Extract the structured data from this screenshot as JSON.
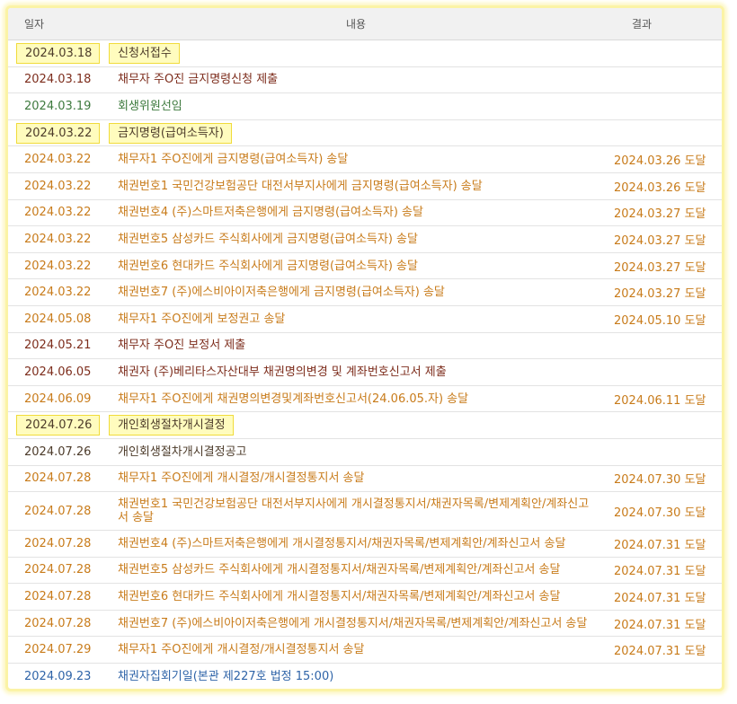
{
  "table": {
    "headers": {
      "date": "일자",
      "content": "내용",
      "result": "결과"
    },
    "rows": [
      {
        "date": "2024.03.18",
        "content": "신청서접수",
        "result": "",
        "color": "dark",
        "highlight": true
      },
      {
        "date": "2024.03.18",
        "content": "채무자 주O진 금지명령신청 제출",
        "result": "",
        "color": "maroon"
      },
      {
        "date": "2024.03.19",
        "content": "회생위원선임",
        "result": "",
        "color": "green"
      },
      {
        "date": "2024.03.22",
        "content": "금지명령(급여소득자)",
        "result": "",
        "color": "dark",
        "highlight": true
      },
      {
        "date": "2024.03.22",
        "content": "채무자1 주O진에게 금지명령(급여소득자) 송달",
        "result": "2024.03.26 도달",
        "color": "orange"
      },
      {
        "date": "2024.03.22",
        "content": "채권번호1 국민건강보험공단 대전서부지사에게 금지명령(급여소득자) 송달",
        "result": "2024.03.26 도달",
        "color": "orange"
      },
      {
        "date": "2024.03.22",
        "content": "채권번호4 (주)스마트저축은행에게 금지명령(급여소득자) 송달",
        "result": "2024.03.27 도달",
        "color": "orange"
      },
      {
        "date": "2024.03.22",
        "content": "채권번호5 삼성카드 주식회사에게 금지명령(급여소득자) 송달",
        "result": "2024.03.27 도달",
        "color": "orange"
      },
      {
        "date": "2024.03.22",
        "content": "채권번호6 현대카드 주식회사에게 금지명령(급여소득자) 송달",
        "result": "2024.03.27 도달",
        "color": "orange"
      },
      {
        "date": "2024.03.22",
        "content": "채권번호7 (주)에스비아이저축은행에게 금지명령(급여소득자) 송달",
        "result": "2024.03.27 도달",
        "color": "orange"
      },
      {
        "date": "2024.05.08",
        "content": "채무자1 주O진에게 보정권고 송달",
        "result": "2024.05.10 도달",
        "color": "orange"
      },
      {
        "date": "2024.05.21",
        "content": "채무자 주O진 보정서 제출",
        "result": "",
        "color": "maroon"
      },
      {
        "date": "2024.06.05",
        "content": "채권자 (주)베리타스자산대부 채권명의변경 및 계좌번호신고서 제출",
        "result": "",
        "color": "maroon"
      },
      {
        "date": "2024.06.09",
        "content": "채무자1 주O진에게 채권명의변경및계좌번호신고서(24.06.05.자) 송달",
        "result": "2024.06.11 도달",
        "color": "orange"
      },
      {
        "date": "2024.07.26",
        "content": "개인회생절차개시결정",
        "result": "",
        "color": "dark",
        "highlight": true
      },
      {
        "date": "2024.07.26",
        "content": "개인회생절차개시결정공고",
        "result": "",
        "color": "dark"
      },
      {
        "date": "2024.07.28",
        "content": "채무자1 주O진에게 개시결정/개시결정통지서 송달",
        "result": "2024.07.30 도달",
        "color": "orange"
      },
      {
        "date": "2024.07.28",
        "content": "채권번호1 국민건강보험공단 대전서부지사에게 개시결정통지서/채권자목록/변제계획안/계좌신고서 송달",
        "result": "2024.07.30 도달",
        "color": "orange",
        "tall": true
      },
      {
        "date": "2024.07.28",
        "content": "채권번호4 (주)스마트저축은행에게 개시결정통지서/채권자목록/변제계획안/계좌신고서 송달",
        "result": "2024.07.31 도달",
        "color": "orange"
      },
      {
        "date": "2024.07.28",
        "content": "채권번호5 삼성카드 주식회사에게 개시결정통지서/채권자목록/변제계획안/계좌신고서 송달",
        "result": "2024.07.31 도달",
        "color": "orange"
      },
      {
        "date": "2024.07.28",
        "content": "채권번호6 현대카드 주식회사에게 개시결정통지서/채권자목록/변제계획안/계좌신고서 송달",
        "result": "2024.07.31 도달",
        "color": "orange"
      },
      {
        "date": "2024.07.28",
        "content": "채권번호7 (주)에스비아이저축은행에게 개시결정통지서/채권자목록/변제계획안/계좌신고서 송달",
        "result": "2024.07.31 도달",
        "color": "orange"
      },
      {
        "date": "2024.07.29",
        "content": "채무자1 주O진에게 개시결정/개시결정통지서 송달",
        "result": "2024.07.31 도달",
        "color": "orange"
      },
      {
        "date": "2024.09.23",
        "content": "채권자집회기일(본관 제227호 법정 15:00)",
        "result": "",
        "color": "blue"
      }
    ]
  }
}
